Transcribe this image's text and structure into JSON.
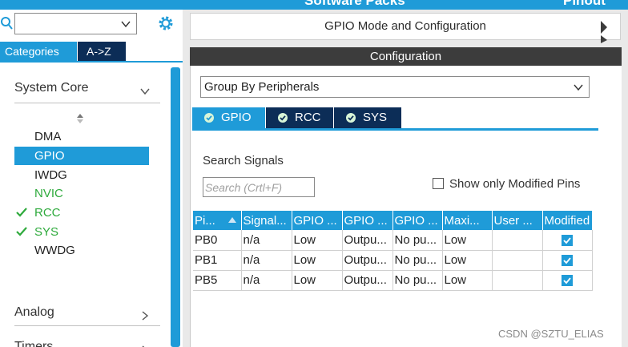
{
  "topbar": {
    "left_text": "Software Packs",
    "right_text": "Pinout"
  },
  "left": {
    "tabs": [
      "Categories",
      "A->Z"
    ],
    "categories": [
      {
        "label": "System Core",
        "arrow": "chevron-down-icon"
      },
      {
        "label": "Analog",
        "arrow": "chevron-right-icon"
      },
      {
        "label": "Timers",
        "arrow": "chevron-right-icon"
      }
    ],
    "items": [
      {
        "label": "DMA",
        "state": "normal"
      },
      {
        "label": "GPIO",
        "state": "selected"
      },
      {
        "label": "IWDG",
        "state": "normal"
      },
      {
        "label": "NVIC",
        "state": "green"
      },
      {
        "label": "RCC",
        "state": "checked"
      },
      {
        "label": "SYS",
        "state": "checked"
      },
      {
        "label": "WWDG",
        "state": "normal"
      }
    ]
  },
  "right": {
    "mode_title": "GPIO Mode and Configuration",
    "config_title": "Configuration",
    "group_select": "Group By Peripherals",
    "tabs": [
      "GPIO",
      "RCC",
      "SYS"
    ],
    "search_label": "Search Signals",
    "search_placeholder": "Search (Crtl+F)",
    "modified_label": "Show only Modified Pins",
    "table": {
      "headers": [
        "Pi...",
        "Signal...",
        "GPIO ...",
        "GPIO ...",
        "GPIO ...",
        "Maxi...",
        "User ...",
        "Modified"
      ],
      "rows": [
        [
          "PB0",
          "n/a",
          "Low",
          "Outpu...",
          "No pu...",
          "Low",
          "",
          true
        ],
        [
          "PB1",
          "n/a",
          "Low",
          "Outpu...",
          "No pu...",
          "Low",
          "",
          true
        ],
        [
          "PB5",
          "n/a",
          "Low",
          "Outpu...",
          "No pu...",
          "Low",
          "",
          true
        ]
      ]
    }
  },
  "watermark": "CSDN @SZTU_ELIAS",
  "colors": {
    "accent": "#1f9bd8",
    "dark_tab": "#0c2d57",
    "green": "#2eaa3c",
    "config_bar": "#3c3c3c"
  }
}
